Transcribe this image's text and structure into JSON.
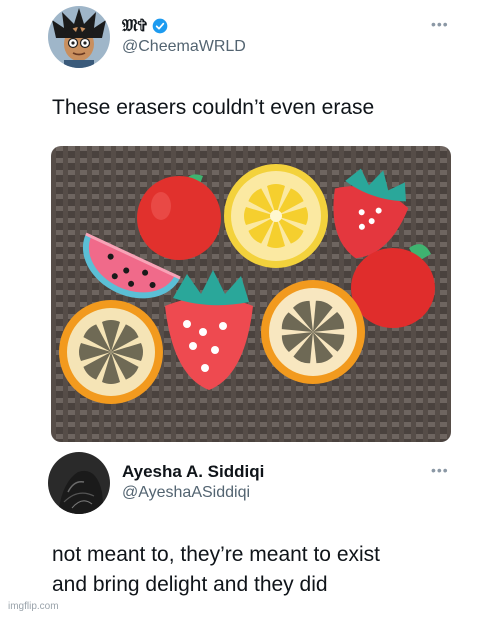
{
  "tweet1": {
    "display_name": "𝔐✞",
    "handle": "@CheemaWRLD",
    "text": "These erasers couldn’t even erase",
    "more_icon": "more-horizontal-icon",
    "verified_icon": "verified-badge-icon",
    "photo_subject": "eraser-photo"
  },
  "tweet2": {
    "display_name": "Ayesha A. Siddiqi",
    "handle": "@AyeshaASiddiqi",
    "text_line1": "not meant to, they’re meant to exist",
    "text_line2": "and bring delight and they did",
    "more_icon": "more-horizontal-icon"
  },
  "watermark": "imgflip.com",
  "colors": {
    "verified": "#1d9bf0",
    "secondary_text": "#536471"
  }
}
